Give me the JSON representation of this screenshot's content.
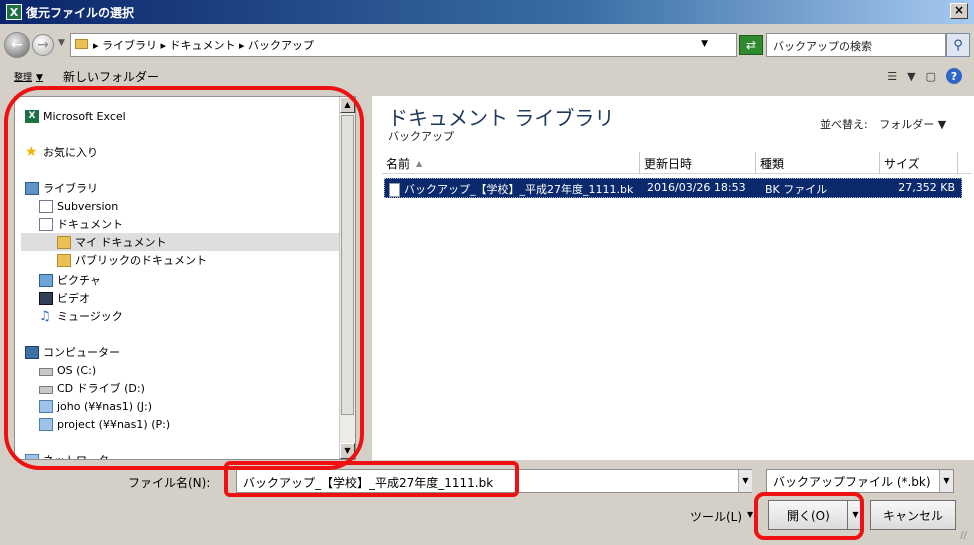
{
  "window": {
    "title": "復元ファイルの選択",
    "close_label": "×"
  },
  "address": {
    "breadcrumb": "▸ ライブラリ ▸ ドキュメント ▸ バックアップ",
    "search_placeholder": "バックアップの検索"
  },
  "toolbar": {
    "organize": "整理",
    "new_folder": "新しいフォルダー",
    "help": "?"
  },
  "nav": {
    "items": [
      {
        "label": "Microsoft Excel",
        "icon": "excel-icon"
      },
      {
        "label": "お気に入り",
        "icon": "star-icon"
      },
      {
        "label": "ライブラリ",
        "icon": "library-icon"
      },
      {
        "label": "Subversion",
        "icon": "document-icon"
      },
      {
        "label": "ドキュメント",
        "icon": "document-icon"
      },
      {
        "label": "マイ ドキュメント",
        "icon": "folder-icon",
        "selected": true
      },
      {
        "label": "パブリックのドキュメント",
        "icon": "folder-icon"
      },
      {
        "label": "ピクチャ",
        "icon": "picture-icon"
      },
      {
        "label": "ビデオ",
        "icon": "video-icon"
      },
      {
        "label": "ミュージック",
        "icon": "music-icon"
      },
      {
        "label": "コンピューター",
        "icon": "computer-icon"
      },
      {
        "label": "OS (C:)",
        "icon": "drive-icon"
      },
      {
        "label": "CD ドライブ (D:)",
        "icon": "cd-drive-icon"
      },
      {
        "label": "joho (¥¥nas1) (J:)",
        "icon": "network-drive-icon"
      },
      {
        "label": "project (¥¥nas1) (P:)",
        "icon": "network-drive-icon"
      },
      {
        "label": "ネットワーク",
        "icon": "network-icon"
      }
    ]
  },
  "library": {
    "title": "ドキュメント ライブラリ",
    "subtitle": "バックアップ",
    "arrange_label": "並べ替え:",
    "arrange_value": "フォルダー"
  },
  "columns": {
    "name": "名前",
    "modified": "更新日時",
    "type": "種類",
    "size": "サイズ"
  },
  "files": [
    {
      "name": "バックアップ_【学校】_平成27年度_1111.bk",
      "modified": "2016/03/26 18:53",
      "type": "BK ファイル",
      "size": "27,352 KB"
    }
  ],
  "bottom": {
    "filename_label": "ファイル名(N):",
    "filename_value": "バックアップ_【学校】_平成27年度_1111.bk",
    "filetype_value": "バックアップファイル (*.bk)",
    "tools_label": "ツール(L)",
    "open_label": "開く(O)",
    "cancel_label": "キャンセル"
  },
  "colors": {
    "highlight": "#ee1111",
    "selection": "#0b2a6e",
    "title_bar": "#0a246a"
  }
}
